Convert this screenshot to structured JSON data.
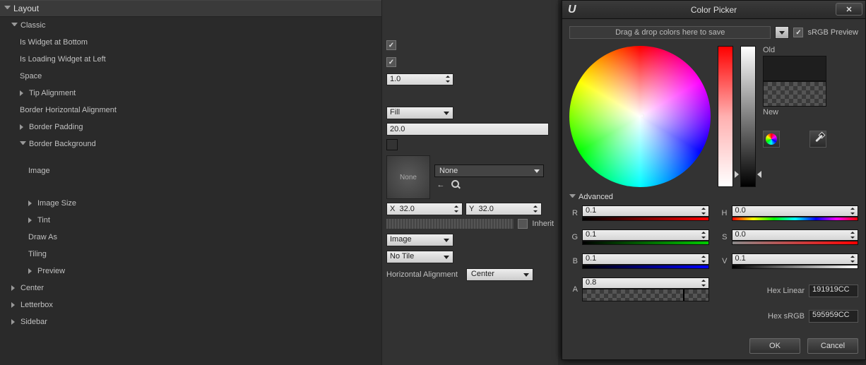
{
  "section": {
    "title": "Layout"
  },
  "tree": {
    "classic": "Classic",
    "isWidgetBottom": "Is Widget at Bottom",
    "isLoadingLeft": "Is Loading Widget at Left",
    "space": "Space",
    "tipAlignment": "Tip Alignment",
    "borderHoriz": "Border Horizontal Alignment",
    "borderPadding": "Border Padding",
    "borderBackground": "Border Background",
    "image": "Image",
    "imageSize": "Image Size",
    "tint": "Tint",
    "drawAs": "Draw As",
    "tiling": "Tiling",
    "preview": "Preview",
    "center": "Center",
    "letterbox": "Letterbox",
    "sidebar": "Sidebar"
  },
  "props": {
    "widgetBottom": true,
    "loadingLeft": true,
    "spaceVal": "1.0",
    "borderHorizVal": "Fill",
    "borderPaddingVal": "20.0",
    "imageNone": "None",
    "assetNone": "None",
    "xLabel": "X",
    "xVal": "32.0",
    "yLabel": "Y",
    "yVal": "32.0",
    "inheritLabel": "Inherit",
    "drawAsVal": "Image",
    "tilingVal": "No Tile",
    "hAlignLabel": "Horizontal Alignment",
    "hAlignVal": "Center"
  },
  "colorPicker": {
    "title": "Color Picker",
    "dragDrop": "Drag & drop colors here to save",
    "srgbPreview": "sRGB Preview",
    "oldLabel": "Old",
    "newLabel": "New",
    "advanced": "Advanced",
    "labels": {
      "R": "R",
      "G": "G",
      "B": "B",
      "A": "A",
      "H": "H",
      "S": "S",
      "V": "V"
    },
    "vals": {
      "R": "0.1",
      "G": "0.1",
      "B": "0.1",
      "A": "0.8",
      "H": "0.0",
      "S": "0.0",
      "V": "0.1"
    },
    "hexLinearLabel": "Hex Linear",
    "hexLinearVal": "191919CC",
    "hexSrgbLabel": "Hex sRGB",
    "hexSrgbVal": "595959CC",
    "ok": "OK",
    "cancel": "Cancel"
  }
}
